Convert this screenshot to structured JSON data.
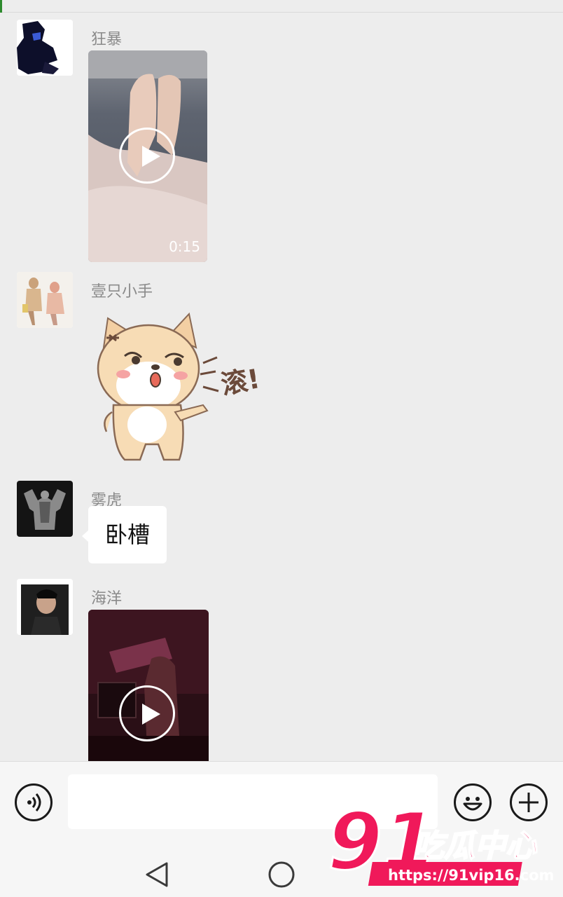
{
  "messages": [
    {
      "sender": "狂暴",
      "type": "video",
      "duration": "0:15"
    },
    {
      "sender": "壹只小手",
      "type": "sticker",
      "sticker_text": "滚!"
    },
    {
      "sender": "雾虎",
      "type": "text",
      "text": "卧槽"
    },
    {
      "sender": "海洋",
      "type": "video"
    }
  ],
  "input_bar": {
    "voice_icon": "voice-icon",
    "emoji_icon": "emoji-icon",
    "plus_icon": "plus-icon",
    "text_value": ""
  },
  "nav": {
    "back_icon": "back-triangle-icon",
    "home_icon": "home-circle-icon"
  },
  "watermark": {
    "logo_number": "91",
    "logo_text": "吃瓜中心",
    "url": "https://91vip16.com"
  },
  "colors": {
    "background": "#ededed",
    "bubble": "#ffffff",
    "watermark": "#f0195a"
  }
}
